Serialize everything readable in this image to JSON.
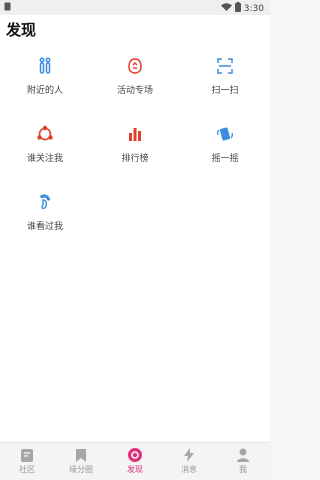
{
  "status": {
    "time": "3:30"
  },
  "header": {
    "title": "发现"
  },
  "grid": {
    "items": [
      {
        "label": "附近的人",
        "icon": "people-icon"
      },
      {
        "label": "活动专场",
        "icon": "event-icon"
      },
      {
        "label": "扫一扫",
        "icon": "scan-icon"
      },
      {
        "label": "谁关注我",
        "icon": "followers-icon"
      },
      {
        "label": "排行榜",
        "icon": "ranking-icon"
      },
      {
        "label": "摇一摇",
        "icon": "shake-icon"
      },
      {
        "label": "谁看过我",
        "icon": "footprint-icon"
      }
    ]
  },
  "bottom_nav": {
    "items": [
      {
        "label": "社区",
        "icon": "community-icon",
        "active": false
      },
      {
        "label": "缘分圈",
        "icon": "bookmark-icon",
        "active": false
      },
      {
        "label": "发现",
        "icon": "discover-icon",
        "active": true
      },
      {
        "label": "消息",
        "icon": "lightning-icon",
        "active": false
      },
      {
        "label": "我",
        "icon": "user-icon",
        "active": false
      }
    ]
  },
  "colors": {
    "active": "#e0317c",
    "inactive": "#a6a6a6",
    "blue": "#3b8de0",
    "red": "#e23e2c"
  }
}
